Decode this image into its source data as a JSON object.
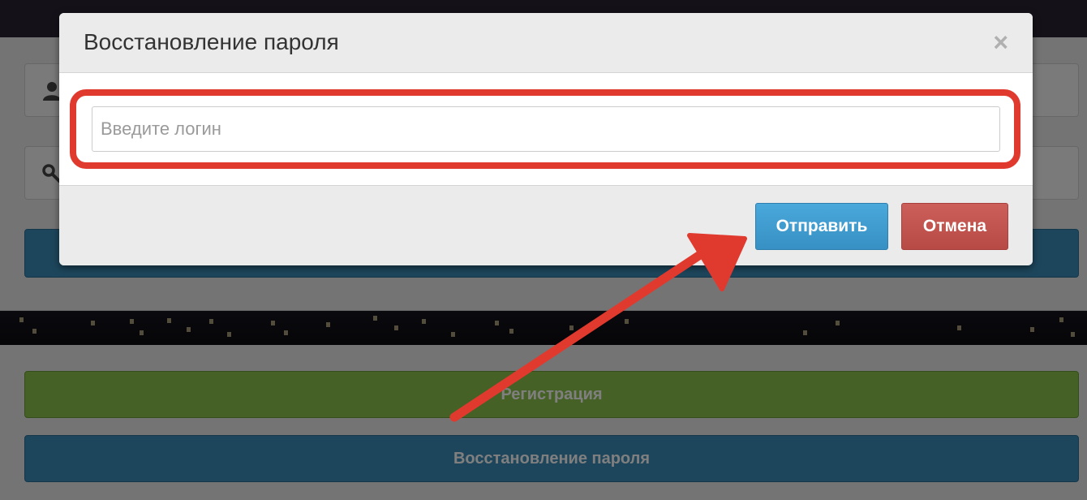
{
  "modal": {
    "title": "Восстановление пароля",
    "close_symbol": "×",
    "input_placeholder": "Введите логин",
    "input_value": "",
    "send_label": "Отправить",
    "cancel_label": "Отмена"
  },
  "background": {
    "register_label": "Регистрация",
    "restore_label": "Восстановление пароля"
  },
  "icons": {
    "user_field": "user-icon",
    "password_field": "key-icon",
    "annotation": "arrow-icon"
  },
  "colors": {
    "highlight": "#e03a2f",
    "send_button": "#3f9ccf",
    "cancel_button": "#c35450",
    "register_button": "#8ac24a",
    "restore_button": "#3a8cb8"
  }
}
